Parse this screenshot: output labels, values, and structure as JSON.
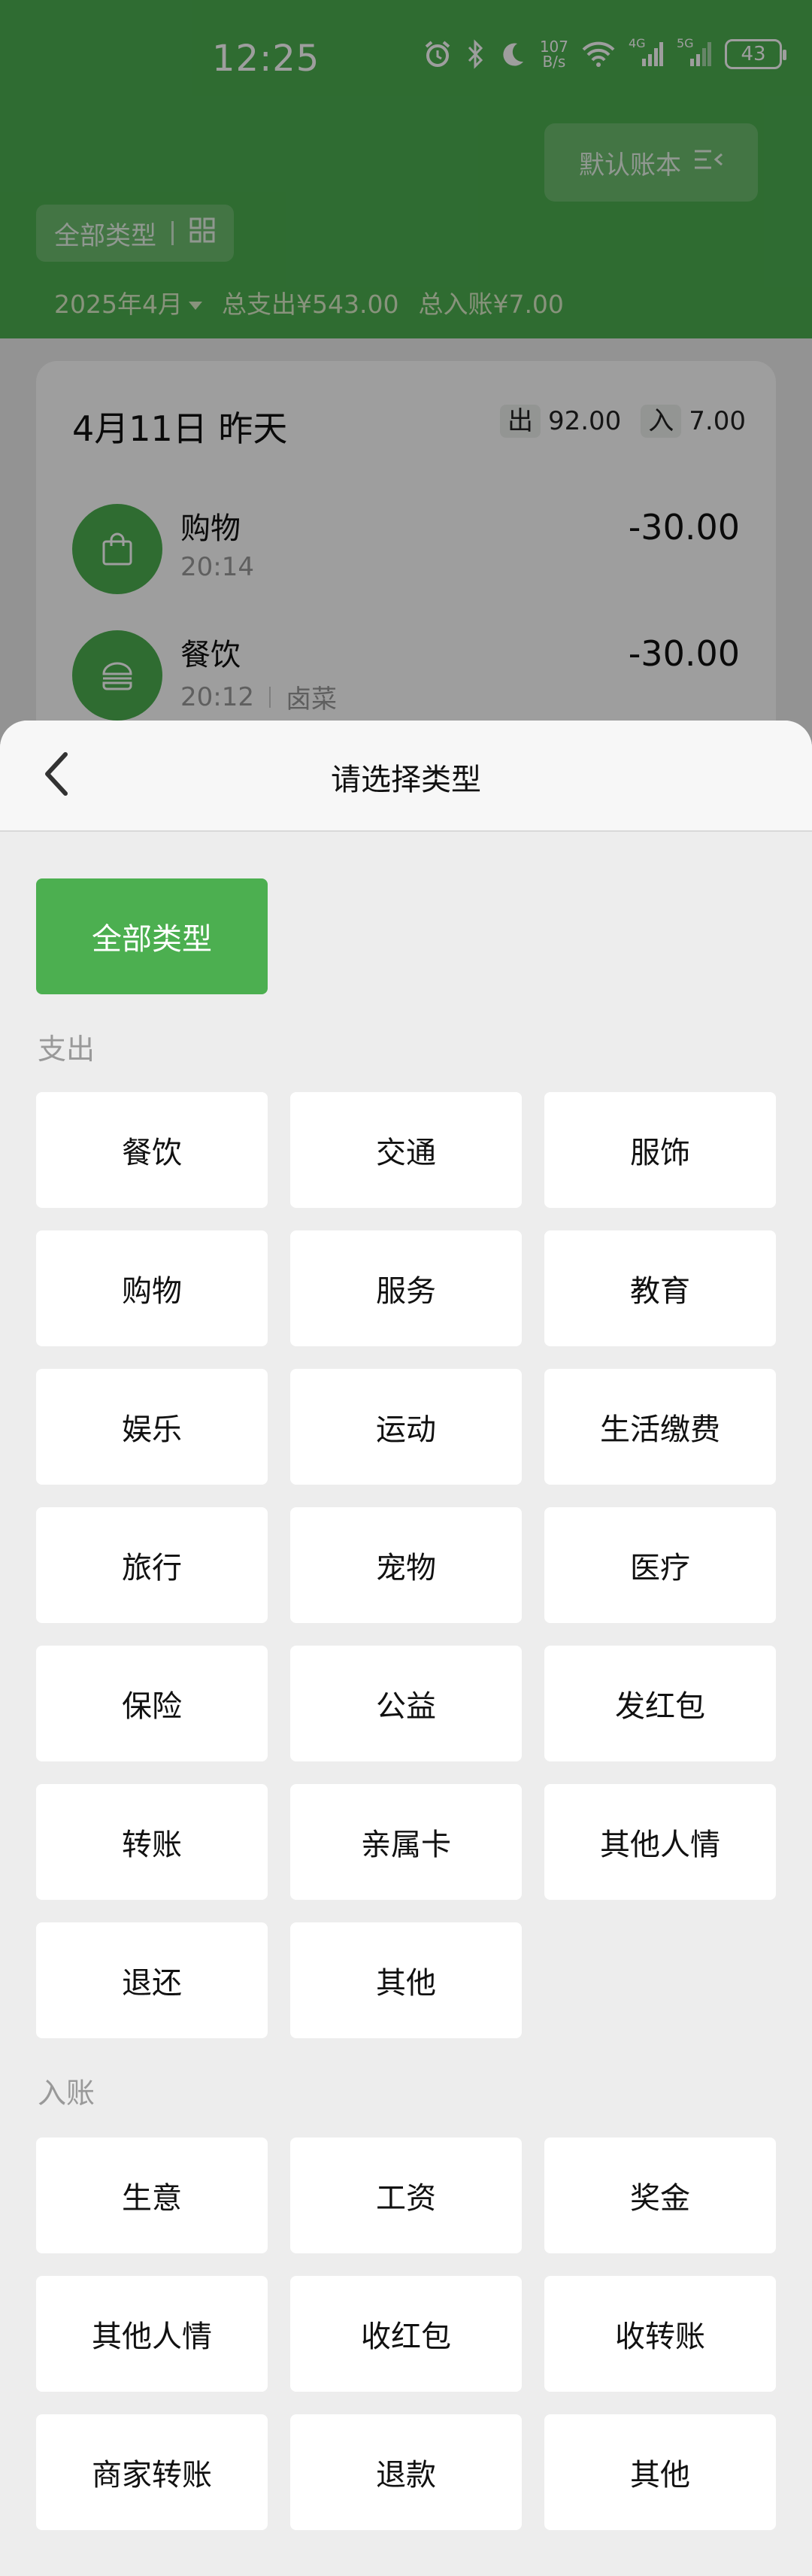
{
  "status_bar": {
    "time": "12:25",
    "net_speed_value": "107",
    "net_speed_unit": "B/s",
    "sim1": "4G",
    "sim2": "5G",
    "battery": "43"
  },
  "header": {
    "ledger_label": "默认账本",
    "type_filter_label": "全部类型",
    "month": "2025年4月",
    "total_expense": "总支出¥543.00",
    "total_income": "总入账¥7.00"
  },
  "day_card": {
    "title": "4月11日 昨天",
    "out_tag": "出",
    "out_value": "92.00",
    "in_tag": "入",
    "in_value": "7.00",
    "transactions": [
      {
        "category": "购物",
        "time": "20:14",
        "note": "",
        "amount": "-30.00",
        "icon": "shopping-bag-icon"
      },
      {
        "category": "餐饮",
        "time": "20:12",
        "note": "卤菜",
        "amount": "-30.00",
        "icon": "burger-icon"
      }
    ]
  },
  "sheet": {
    "title": "请选择类型",
    "all_label": "全部类型",
    "expense_label": "支出",
    "expense_types": [
      "餐饮",
      "交通",
      "服饰",
      "购物",
      "服务",
      "教育",
      "娱乐",
      "运动",
      "生活缴费",
      "旅行",
      "宠物",
      "医疗",
      "保险",
      "公益",
      "发红包",
      "转账",
      "亲属卡",
      "其他人情",
      "退还",
      "其他"
    ],
    "income_label": "入账",
    "income_types": [
      "生意",
      "工资",
      "奖金",
      "其他人情",
      "收红包",
      "收转账",
      "商家转账",
      "退款",
      "其他"
    ]
  },
  "colors": {
    "accent": "#4caf50",
    "sheet_bg": "#ededed"
  }
}
